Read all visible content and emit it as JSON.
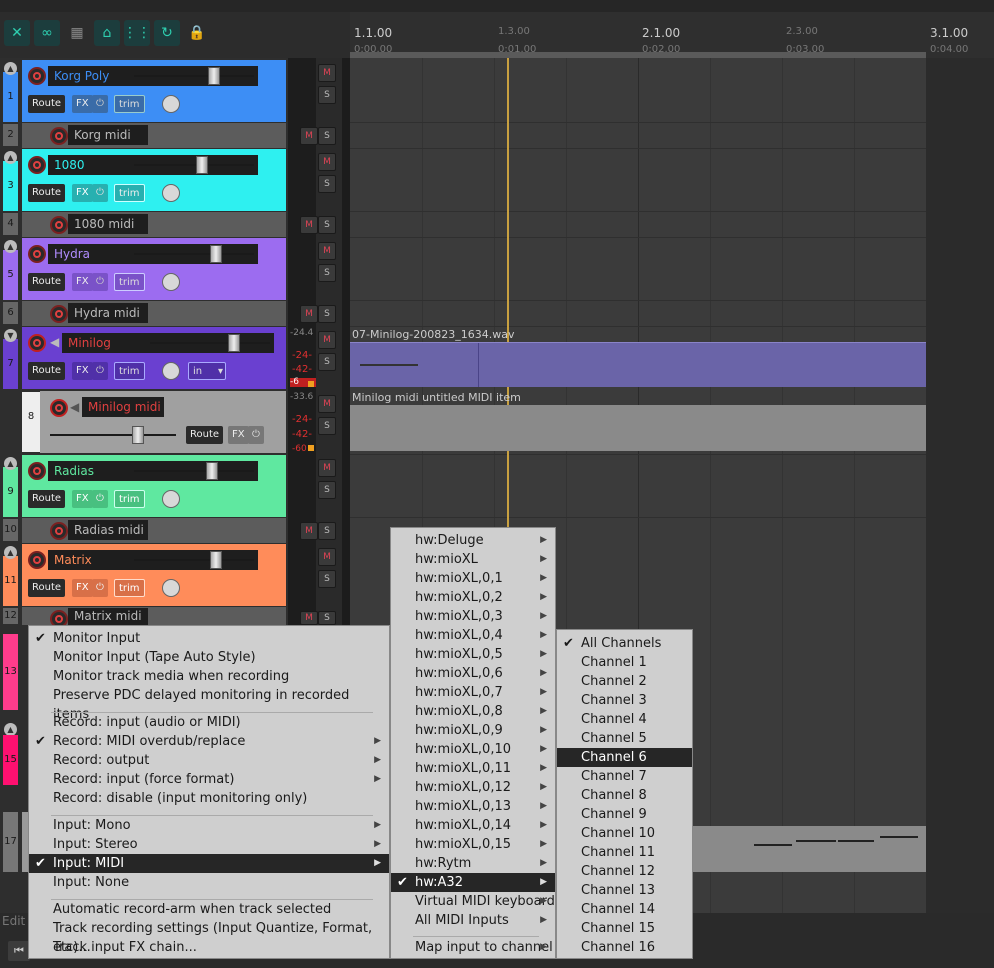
{
  "ruler": {
    "marks": [
      {
        "label": "1.1.00",
        "sub": "0:00.00"
      },
      {
        "label": "1.3.00",
        "sub": "0:01.00"
      },
      {
        "label": "2.1.00",
        "sub": "0:02.00"
      },
      {
        "label": "2.3.00",
        "sub": "0:03.00"
      },
      {
        "label": "3.1.00",
        "sub": "0:04.00"
      }
    ]
  },
  "tracks": {
    "t1": {
      "num": "1",
      "name": "Korg Poly",
      "route": "Route",
      "fx": "FX",
      "trim": "trim"
    },
    "t2": {
      "num": "2",
      "name": "Korg midi"
    },
    "t3": {
      "num": "3",
      "name": "1080",
      "route": "Route",
      "fx": "FX",
      "trim": "trim"
    },
    "t4": {
      "num": "4",
      "name": "1080 midi"
    },
    "t5": {
      "num": "5",
      "name": "Hydra",
      "route": "Route",
      "fx": "FX",
      "trim": "trim"
    },
    "t6": {
      "num": "6",
      "name": "Hydra midi"
    },
    "t7": {
      "num": "7",
      "name": "Minilog",
      "route": "Route",
      "fx": "FX",
      "trim": "trim",
      "input": "in"
    },
    "t8": {
      "num": "8",
      "name": "Minilog midi",
      "route": "Route",
      "fx": "FX"
    },
    "t9": {
      "num": "9",
      "name": "Radias",
      "route": "Route",
      "fx": "FX",
      "trim": "trim"
    },
    "t10": {
      "num": "10",
      "name": "Radias midi"
    },
    "t11": {
      "num": "11",
      "name": "Matrix",
      "route": "Route",
      "fx": "FX",
      "trim": "trim"
    },
    "t12": {
      "num": "12",
      "name": "Matrix midi"
    },
    "t13": {
      "num": "13"
    },
    "t15": {
      "num": "15"
    },
    "t17": {
      "num": "17"
    }
  },
  "meters": {
    "m7_peak": "-24.4",
    "m7_a": "-24-",
    "m7_b": "-42-",
    "m7_c": "-6",
    "m8_peak": "-33.6",
    "m8_a": "-24-",
    "m8_b": "-42-",
    "m8_c": "-60"
  },
  "mute_label": "M",
  "solo_label": "S",
  "clips": {
    "audio": "07-Minilog-200823_1634.wav",
    "midi": "Minilog midi untitled MIDI item"
  },
  "edit_label": "Edit",
  "main_menu": [
    {
      "label": "Monitor Input",
      "checked": true
    },
    {
      "label": "Monitor Input (Tape Auto Style)"
    },
    {
      "label": "Monitor track media when recording"
    },
    {
      "label": "Preserve PDC delayed monitoring in recorded items"
    },
    {
      "label": "Record: input (audio or MIDI)"
    },
    {
      "label": "Record: MIDI overdub/replace",
      "checked": true,
      "sub": true
    },
    {
      "label": "Record: output",
      "sub": true
    },
    {
      "label": "Record: input (force format)",
      "sub": true
    },
    {
      "label": "Record: disable (input monitoring only)"
    },
    {
      "label": "Input: Mono",
      "sub": true
    },
    {
      "label": "Input: Stereo",
      "sub": true
    },
    {
      "label": "Input: MIDI",
      "checked": true,
      "sub": true,
      "highlight": true
    },
    {
      "label": "Input: None"
    },
    {
      "label": "Automatic record-arm when track selected"
    },
    {
      "label": "Track recording settings (Input Quantize, Format, etc)..."
    },
    {
      "label": "Track input FX chain..."
    }
  ],
  "midi_menu": [
    {
      "label": "hw:Deluge",
      "sub": true
    },
    {
      "label": "hw:mioXL",
      "sub": true
    },
    {
      "label": "hw:mioXL,0,1",
      "sub": true
    },
    {
      "label": "hw:mioXL,0,2",
      "sub": true
    },
    {
      "label": "hw:mioXL,0,3",
      "sub": true
    },
    {
      "label": "hw:mioXL,0,4",
      "sub": true
    },
    {
      "label": "hw:mioXL,0,5",
      "sub": true
    },
    {
      "label": "hw:mioXL,0,6",
      "sub": true
    },
    {
      "label": "hw:mioXL,0,7",
      "sub": true
    },
    {
      "label": "hw:mioXL,0,8",
      "sub": true
    },
    {
      "label": "hw:mioXL,0,9",
      "sub": true
    },
    {
      "label": "hw:mioXL,0,10",
      "sub": true
    },
    {
      "label": "hw:mioXL,0,11",
      "sub": true
    },
    {
      "label": "hw:mioXL,0,12",
      "sub": true
    },
    {
      "label": "hw:mioXL,0,13",
      "sub": true
    },
    {
      "label": "hw:mioXL,0,14",
      "sub": true
    },
    {
      "label": "hw:mioXL,0,15",
      "sub": true
    },
    {
      "label": "hw:Rytm",
      "sub": true
    },
    {
      "label": "hw:A32",
      "sub": true,
      "checked": true,
      "highlight": true
    },
    {
      "label": "Virtual MIDI keyboard",
      "sub": true
    },
    {
      "label": "All MIDI Inputs",
      "sub": true
    },
    {
      "label": "Map input to channel",
      "sub": true
    }
  ],
  "channel_menu": [
    {
      "label": "All Channels",
      "checked": true
    },
    {
      "label": "Channel 1"
    },
    {
      "label": "Channel 2"
    },
    {
      "label": "Channel 3"
    },
    {
      "label": "Channel 4"
    },
    {
      "label": "Channel 5"
    },
    {
      "label": "Channel 6",
      "highlight": true
    },
    {
      "label": "Channel 7"
    },
    {
      "label": "Channel 8"
    },
    {
      "label": "Channel 9"
    },
    {
      "label": "Channel 10"
    },
    {
      "label": "Channel 11"
    },
    {
      "label": "Channel 12"
    },
    {
      "label": "Channel 13"
    },
    {
      "label": "Channel 14"
    },
    {
      "label": "Channel 15"
    },
    {
      "label": "Channel 16"
    }
  ],
  "colors": {
    "korg": "#3d8ef5",
    "1080": "#2ef0f0",
    "hydra": "#9c6cf0",
    "minilog": "#6a40d0",
    "minilog_midi": "#a0a0a0",
    "radias": "#5fe8a0",
    "matrix": "#ff8c5a",
    "pink": "#ff3c8c",
    "accent": "#2ecfb0",
    "cursor": "#c8a040",
    "menu_bg": "#cfcfcf",
    "menu_highlight": "#262626"
  }
}
